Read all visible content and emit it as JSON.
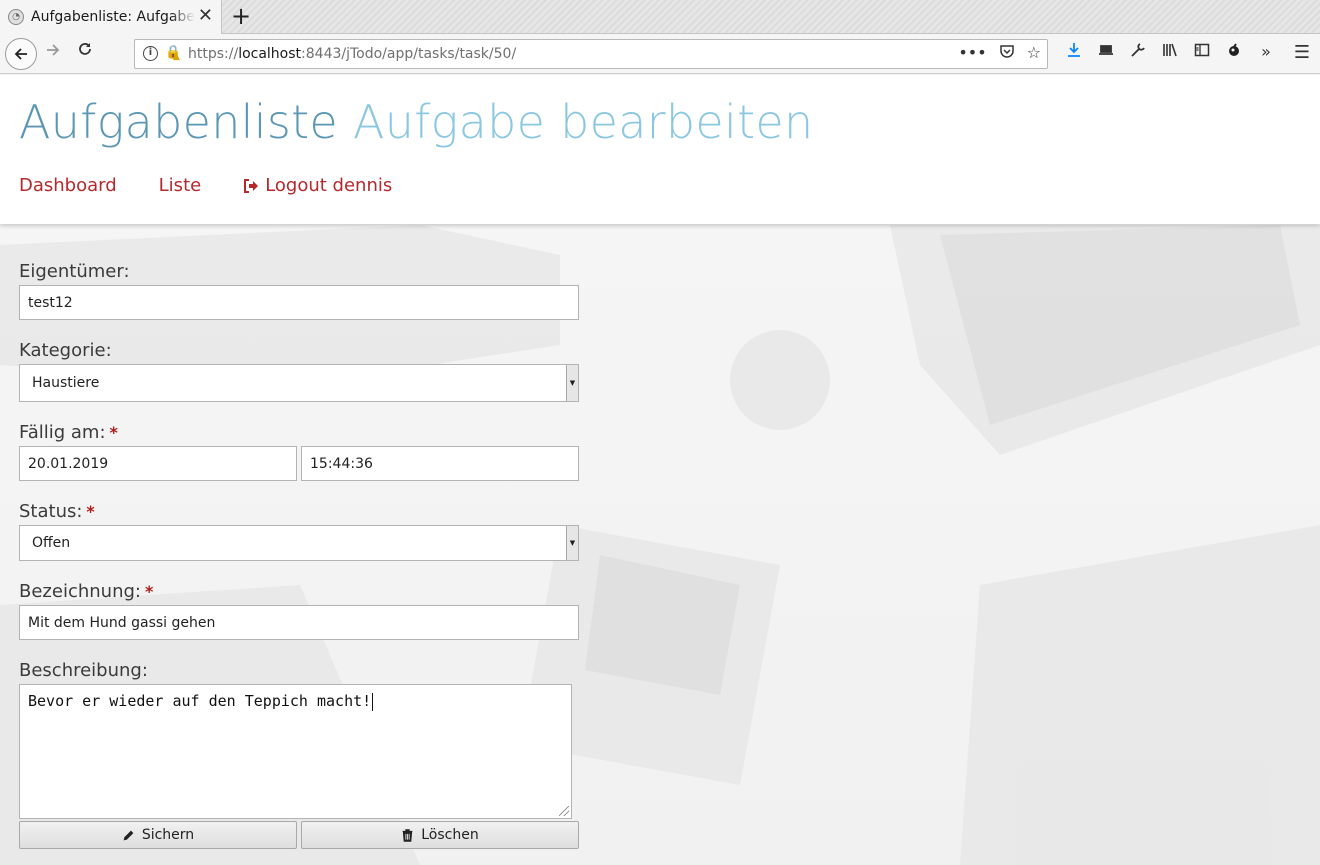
{
  "browser": {
    "tab_title": "Aufgabenliste: Aufgabe bearbeiten",
    "new_tab": "+",
    "url_prefix": "https://",
    "url_host": "localhost",
    "url_rest": ":8443/jTodo/app/tasks/task/50/"
  },
  "header": {
    "title_main": "Aufgabenliste",
    "title_sub": "Aufgabe bearbeiten",
    "nav": {
      "dashboard": "Dashboard",
      "liste": "Liste",
      "logout": "Logout dennis"
    }
  },
  "form": {
    "owner_label": "Eigentümer:",
    "owner_value": "test12",
    "category_label": "Kategorie:",
    "category_value": "Haustiere",
    "due_label": "Fällig am:",
    "due_date": "20.01.2019",
    "due_time": "15:44:36",
    "status_label": "Status:",
    "status_value": "Offen",
    "title_label": "Bezeichnung:",
    "title_value": "Mit dem Hund gassi gehen",
    "description_label": "Beschreibung:",
    "description_value": "Bevor er wieder auf den Teppich macht!",
    "required_mark": "*",
    "save_label": "Sichern",
    "delete_label": "Löschen"
  },
  "colors": {
    "title_main": "#5b97b4",
    "title_sub": "#8cc7e1",
    "nav_link": "#b5282c",
    "required": "#b31b1b"
  }
}
